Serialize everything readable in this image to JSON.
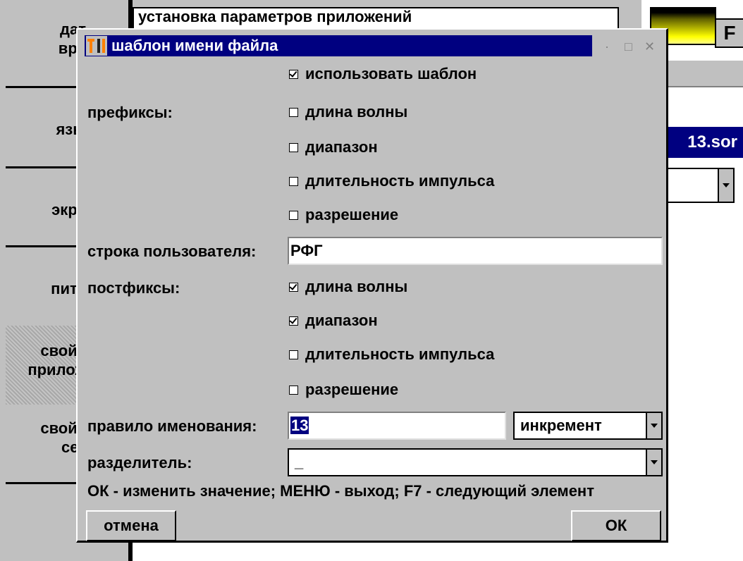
{
  "background": {
    "sidebar_items": [
      "дат\nвре",
      "язы",
      "экра",
      "пита",
      "свойс\nприлож",
      "свойс\nсет"
    ],
    "top_title": "установка параметров приложений",
    "f_key": "F",
    "filename_tail": "13.sor"
  },
  "dialog": {
    "title": "шаблон имени файла",
    "use_template_label": "использовать шаблон",
    "use_template_checked": true,
    "prefixes_label": "префиксы:",
    "prefixes": [
      {
        "label": "длина волны",
        "checked": false
      },
      {
        "label": "диапазон",
        "checked": false
      },
      {
        "label": "длительность импульса",
        "checked": false
      },
      {
        "label": "разрешение",
        "checked": false
      }
    ],
    "user_string_label": "строка пользователя:",
    "user_string_value": "РФГ",
    "postfixes_label": "постфиксы:",
    "postfixes": [
      {
        "label": "длина волны",
        "checked": true
      },
      {
        "label": "диапазон",
        "checked": true
      },
      {
        "label": "длительность импульса",
        "checked": false
      },
      {
        "label": "разрешение",
        "checked": false
      }
    ],
    "naming_rule_label": "правило именования:",
    "naming_rule_value": "13",
    "naming_mode": "инкремент",
    "separator_label": "разделитель:",
    "separator_value": "_",
    "hint": "ОК - изменить значение; МЕНЮ - выход; F7 - следующий элемент",
    "cancel_label": "отмена",
    "ok_label": "ОК"
  }
}
